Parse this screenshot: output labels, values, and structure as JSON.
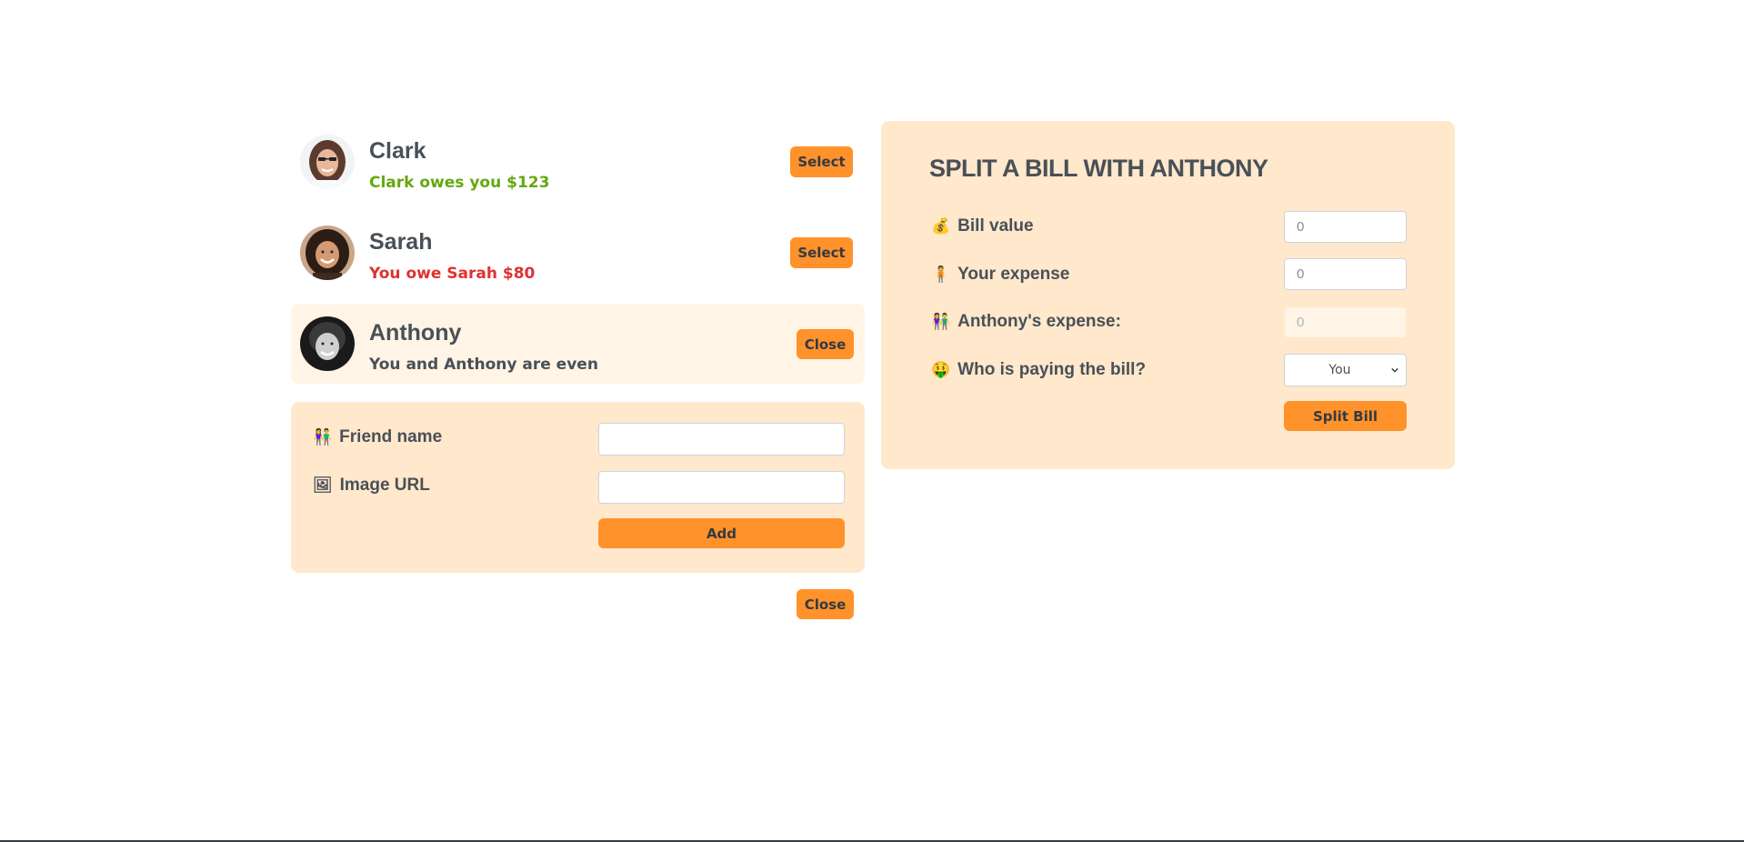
{
  "friends": [
    {
      "name": "Clark",
      "status": "Clark owes you $123",
      "status_color": "#66a80f",
      "button": "Select"
    },
    {
      "name": "Sarah",
      "status": "You owe Sarah $80",
      "status_color": "#e03131",
      "button": "Select"
    },
    {
      "name": "Anthony",
      "status": "You and Anthony are even",
      "status_color": "#495057",
      "button": "Close"
    }
  ],
  "add_form": {
    "name_label": "Friend name",
    "name_icon": "people-holding-hands-icon",
    "name_value": "",
    "image_label": "Image URL",
    "image_icon": "framed-picture-icon",
    "image_value": "",
    "add_button": "Add"
  },
  "close_button": "Close",
  "split": {
    "title": "SPLIT A BILL WITH ANTHONY",
    "bill_label": "Bill value",
    "bill_icon": "money-bag-icon",
    "bill_value": "0",
    "your_label": "Your expense",
    "your_icon": "person-standing-icon",
    "your_value": "0",
    "friend_label": "Anthony's expense:",
    "friend_icon": "people-holding-hands-icon",
    "friend_value": "0",
    "payer_label": "Who is paying the bill?",
    "payer_icon": "money-mouth-face-icon",
    "payer_value": "You",
    "submit_button": "Split Bill"
  },
  "colors": {
    "accent": "#ff922b",
    "panel": "#ffe8cc",
    "selected": "#fff4e6",
    "text": "#495057",
    "owed": "#66a80f",
    "owe": "#e03131"
  }
}
